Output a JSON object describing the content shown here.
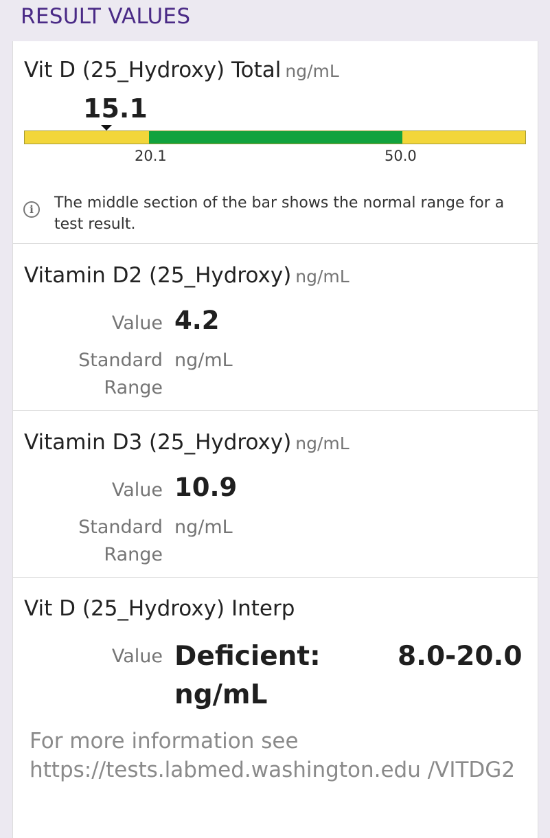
{
  "header": {
    "title": "RESULT VALUES"
  },
  "total": {
    "name": "Vit D (25_Hydroxy) Total",
    "unit": "ng/mL",
    "result": "15.1",
    "range_low": "20.1",
    "range_high": "50.0",
    "bar_colors": {
      "low": "#f2d63a",
      "normal": "#12a23e",
      "high": "#f2d63a"
    },
    "info_icon": "info-icon",
    "info_text": "The middle section of the bar shows the normal range for a test result."
  },
  "d2": {
    "name": "Vitamin D2 (25_Hydroxy)",
    "unit": "ng/mL",
    "value_label": "Value",
    "value": "4.2",
    "range_label": "Standard Range",
    "range_value": "ng/mL"
  },
  "d3": {
    "name": "Vitamin D3 (25_Hydroxy)",
    "unit": "ng/mL",
    "value_label": "Value",
    "value": "10.9",
    "range_label": "Standard Range",
    "range_value": "ng/mL"
  },
  "interp": {
    "name": "Vit D (25_Hydroxy) Interp",
    "value_label": "Value",
    "value_text": "Deficient: ng/mL",
    "value_range": "8.0-20.0",
    "more_info": "For more information see https://tests.labmed.washington.edu /VITDG2"
  }
}
